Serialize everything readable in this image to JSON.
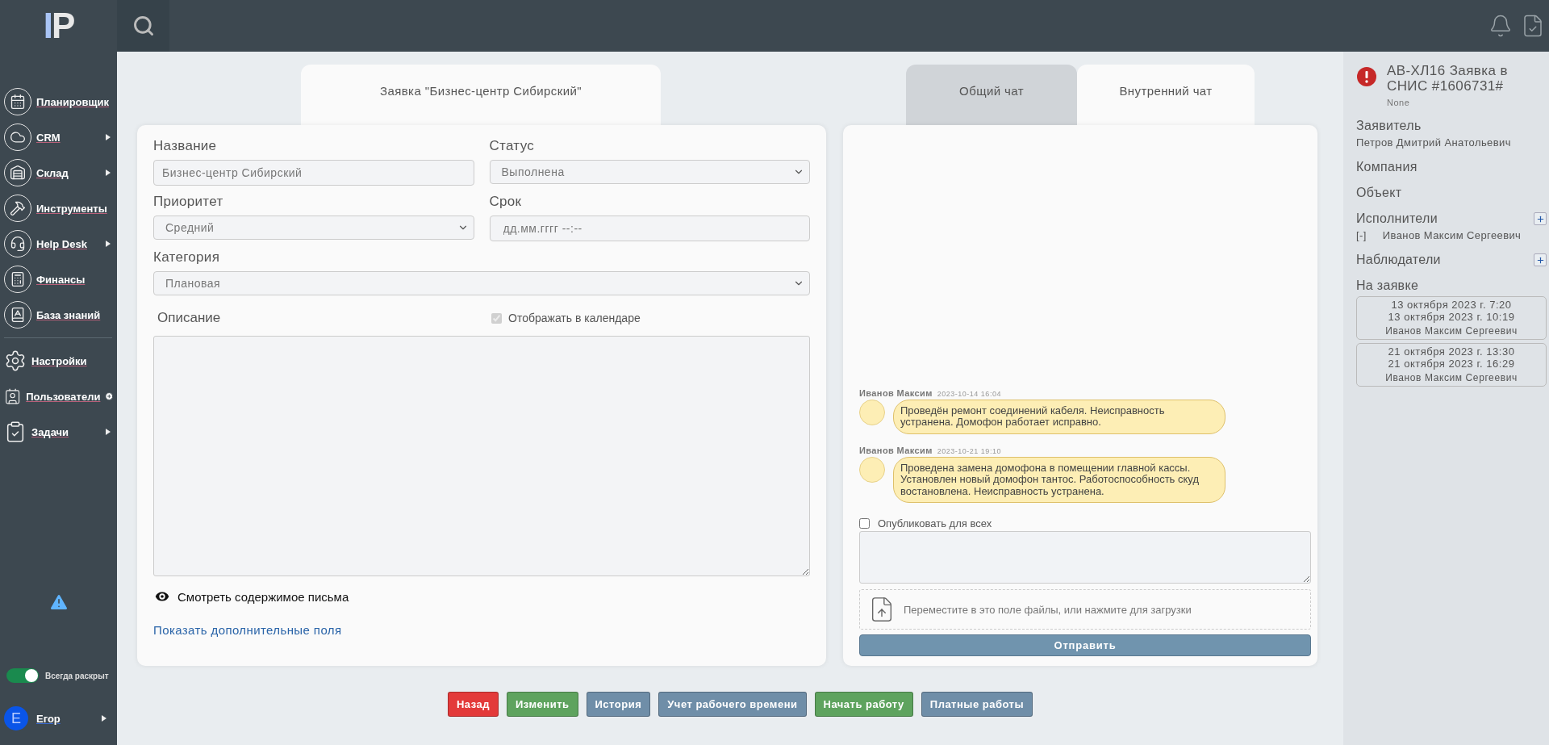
{
  "sidebar": {
    "logo": "IP",
    "items": [
      {
        "label": "Планировщик",
        "submenu": false,
        "add": false
      },
      {
        "label": "CRM",
        "submenu": true,
        "add": false
      },
      {
        "label": "Склад",
        "submenu": true,
        "add": false
      },
      {
        "label": "Инструменты",
        "submenu": false,
        "add": false
      },
      {
        "label": "Help Desk",
        "submenu": true,
        "add": false
      },
      {
        "label": "Финансы",
        "submenu": false,
        "add": false
      },
      {
        "label": "База знаний",
        "submenu": false,
        "add": false
      }
    ],
    "items2": [
      {
        "label": "Настройки",
        "submenu": false,
        "add": false
      },
      {
        "label": "Пользователи",
        "submenu": false,
        "add": true
      },
      {
        "label": "Задачи",
        "submenu": true,
        "add": false
      }
    ],
    "toggle": {
      "label": "Всегда раскрыт",
      "on": true
    },
    "user": {
      "initial": "Е",
      "name": "Егор",
      "submenu": true
    }
  },
  "form": {
    "tab": "Заявка \"Бизнес-центр Сибирский\"",
    "rows": [
      [
        {
          "label": "Название",
          "kind": "text",
          "value": "Бизнес-центр Сибирский"
        },
        {
          "label": "Статус",
          "kind": "select",
          "value": "Выполнена"
        }
      ],
      [
        {
          "label": "Приоритет",
          "kind": "select",
          "value": "Средний"
        },
        {
          "label": "Срок",
          "kind": "datetime",
          "placeholder": "дд.мм.гггг --:--"
        }
      ],
      [
        {
          "label": "Категория",
          "kind": "select",
          "value": "Плановая"
        }
      ]
    ],
    "description_label": "Описание",
    "calendar": {
      "label": "Отображать в календаре",
      "checked": true,
      "disabled": true
    },
    "view_letter": "Смотреть содержимое письма",
    "more_fields": "Показать дополнительные поля"
  },
  "chat": {
    "tabs": [
      {
        "label": "Общий чат",
        "selected": false
      },
      {
        "label": "Внутренний чат",
        "selected": true
      }
    ],
    "messages": [
      {
        "author": "Иванов Максим",
        "time": "2023-10-14 16:04",
        "text": "Проведён ремонт соединений кабеля. Неисправность устранена. Домофон работает исправно."
      },
      {
        "author": "Иванов Максим",
        "time": "2023-10-21 19:10",
        "text": "Проведена замена домофона в помещении главной кассы. Установлен новый домофон тантос. Работоспособность скуд востановлена. Неисправность устранена."
      }
    ],
    "publish": {
      "label": "Опубликовать для всех",
      "checked": false
    },
    "dropzone": "Переместите в это поле файлы, или нажмите для загрузки",
    "send": "Отправить"
  },
  "buttons": [
    {
      "label": "Назад",
      "color": "#e33a3a"
    },
    {
      "label": "Изменить",
      "color": "#5ea35e"
    },
    {
      "label": "История",
      "color": "#6f8ea8"
    },
    {
      "label": "Учет рабочего времени",
      "color": "#6f8ea8"
    },
    {
      "label": "Начать работу",
      "color": "#5ea35e"
    },
    {
      "label": "Платные работы",
      "color": "#6f8ea8"
    }
  ],
  "right_panel": {
    "title": "АВ-ХЛ16 Заявка в СНИС #1606731#",
    "subtitle": "None",
    "applicant": {
      "label": "Заявитель",
      "value": "Петров Дмитрий Анатольевич"
    },
    "company": {
      "label": "Компания"
    },
    "object": {
      "label": "Объект"
    },
    "executors": {
      "label": "Исполнители",
      "items": [
        {
          "remove": "[-]",
          "name": "Иванов Максим Сергеевич"
        }
      ]
    },
    "observers": {
      "label": "Наблюдатели"
    },
    "on_request": {
      "label": "На заявке",
      "entries": [
        {
          "start": "13 октября 2023 г. 7:20",
          "end": "13 октября 2023 г. 10:19",
          "name": "Иванов Максим Сергеевич"
        },
        {
          "start": "21 октября 2023 г. 13:30",
          "end": "21 октября 2023 г. 16:29",
          "name": "Иванов Максим Сергеевич"
        }
      ]
    }
  }
}
